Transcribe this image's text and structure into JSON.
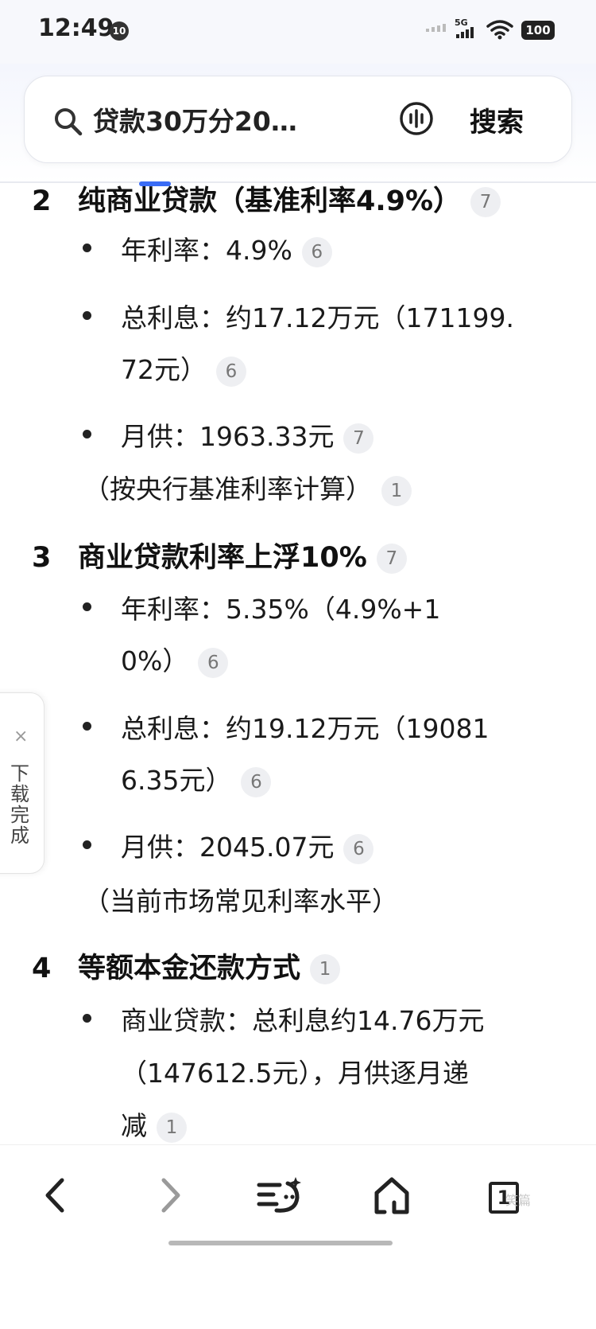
{
  "status_bar": {
    "time": "12:49",
    "notification_count": "10",
    "network_type": "5G",
    "battery": "100"
  },
  "search": {
    "query": "贷款30万分20…",
    "button_label": "搜索"
  },
  "sections": [
    {
      "number": "2",
      "title": "纯商业贷款（基准利率4.9%）",
      "cite": "7",
      "items": [
        {
          "lines": [
            "年利率：4.9%"
          ],
          "cite": "6"
        },
        {
          "lines": [
            "总利息：约17.12万元（171199.",
            "72元）"
          ],
          "cite": "6"
        },
        {
          "lines": [
            "月供：1963.33元"
          ],
          "cite": "7"
        }
      ],
      "note": "（按央行基准利率计算）",
      "note_cite": "1"
    },
    {
      "number": "3",
      "title": "商业贷款利率上浮10%",
      "cite": "7",
      "items": [
        {
          "lines": [
            "年利率：5.35%（4.9%+1",
            "0%）"
          ],
          "cite": "6"
        },
        {
          "lines": [
            "总利息：约19.12万元（19081",
            "6.35元）"
          ],
          "cite": "6"
        },
        {
          "lines": [
            "月供：2045.07元"
          ],
          "cite": "6"
        }
      ],
      "note": "（当前市场常见利率水平）"
    },
    {
      "number": "4",
      "title": "等额本金还款方式",
      "cite": "1",
      "items": [
        {
          "lines": [
            "商业贷款：总利息约14.76万元",
            "（147612.5元），月供逐月递",
            "减"
          ],
          "cite": "1"
        }
      ]
    }
  ],
  "download_widget": {
    "label": "下载完成",
    "close_label": "×"
  },
  "bottom_nav": {
    "tab_count": "1",
    "watermark": "笑篇"
  }
}
